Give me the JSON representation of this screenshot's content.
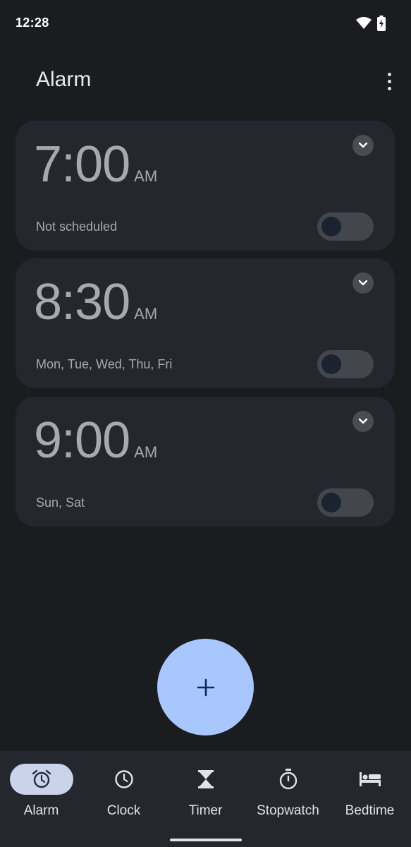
{
  "status_bar": {
    "time": "12:28",
    "icons": [
      "wifi-icon",
      "battery-icon"
    ]
  },
  "app_bar": {
    "title": "Alarm",
    "menu_icon": "more-vert-icon"
  },
  "alarms": [
    {
      "time": "7:00",
      "ampm": "AM",
      "days": "Not scheduled",
      "enabled": false
    },
    {
      "time": "8:30",
      "ampm": "AM",
      "days": "Mon, Tue, Wed, Thu, Fri",
      "enabled": false
    },
    {
      "time": "9:00",
      "ampm": "AM",
      "days": "Sun, Sat",
      "enabled": false
    }
  ],
  "fab": {
    "icon": "add-icon",
    "glyph": "+"
  },
  "bottom_nav": {
    "active": "Alarm",
    "items": [
      {
        "label": "Alarm",
        "icon": "alarm-icon"
      },
      {
        "label": "Clock",
        "icon": "clock-icon"
      },
      {
        "label": "Timer",
        "icon": "hourglass-icon"
      },
      {
        "label": "Stopwatch",
        "icon": "stopwatch-icon"
      },
      {
        "label": "Bedtime",
        "icon": "bed-icon"
      }
    ]
  },
  "colors": {
    "background": "#1b1c20",
    "card": "#25272e",
    "fab": "#a9c7ff",
    "nav_active_pill": "#c9d4ea",
    "text_muted": "#a8a9ae"
  }
}
